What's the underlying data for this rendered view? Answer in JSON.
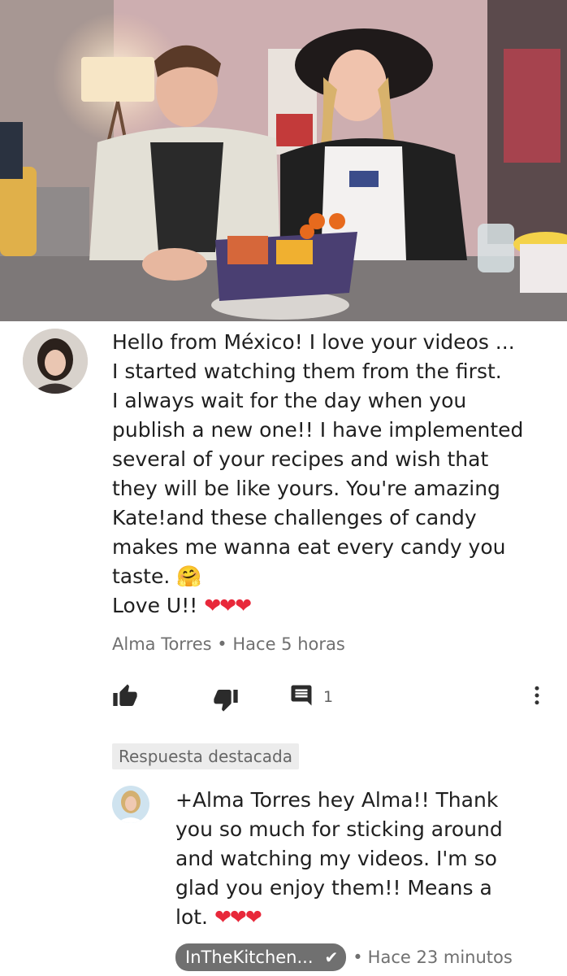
{
  "video": {
    "thumbnail": "video-frame-two-hosts-candy-basket"
  },
  "comment": {
    "avatar": "commenter-avatar",
    "lines": [
      "Hello from México! I love your videos ...",
      "I started watching them from the first.",
      "I always wait for the day when you",
      "publish a new one!! I have implemented",
      "several of your recipes and wish that",
      "they will be like yours. You're amazing",
      "Kate!and these challenges of candy",
      "makes me wanna eat every candy you",
      "taste. 🤗",
      "Love U!! "
    ],
    "closing_hearts": "❤❤❤",
    "author": "Alma Torres",
    "separator": "•",
    "time": "Hace 5 horas",
    "reply_count": "1",
    "icons": {
      "like": "thumbs-up-icon",
      "dislike": "thumbs-down-icon",
      "reply": "comment-icon",
      "menu": "more-vert-icon"
    }
  },
  "featured_label": "Respuesta destacada",
  "reply": {
    "avatar": "creator-avatar",
    "lines": [
      "+Alma Torres hey Alma!! Thank",
      "you so much for sticking around",
      "and watching my videos. I'm so",
      "glad you enjoy them!! Means a",
      "lot. "
    ],
    "closing_hearts": "❤❤❤",
    "channel_name": "InTheKitchen...",
    "verified_icon": "check-icon",
    "separator": "•",
    "time": "Hace 23 minutos"
  },
  "colors": {
    "hearts": "#e8283a",
    "meta_gray": "#707070",
    "badge_bg": "#707070",
    "featured_bg": "#ececec"
  }
}
